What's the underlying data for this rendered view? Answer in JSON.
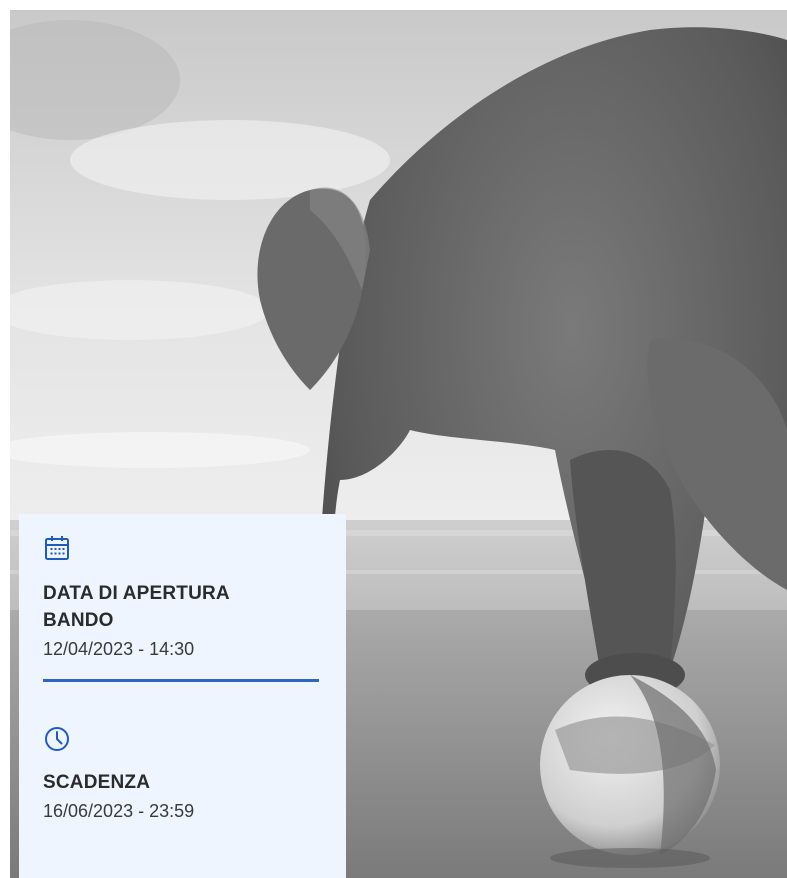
{
  "hero": {
    "icon": "elephant-on-ball-photo"
  },
  "opening": {
    "icon": "calendar-icon",
    "title_line1": "DATA DI APERTURA",
    "title_line2": "BANDO",
    "value": "12/04/2023 - 14:30"
  },
  "deadline": {
    "icon": "clock-icon",
    "title": "SCADENZA",
    "value": "16/06/2023 - 23:59"
  },
  "colors": {
    "accent": "#1f5bbd",
    "card_background": "#eef5ff",
    "divider": "#2f66c4"
  }
}
